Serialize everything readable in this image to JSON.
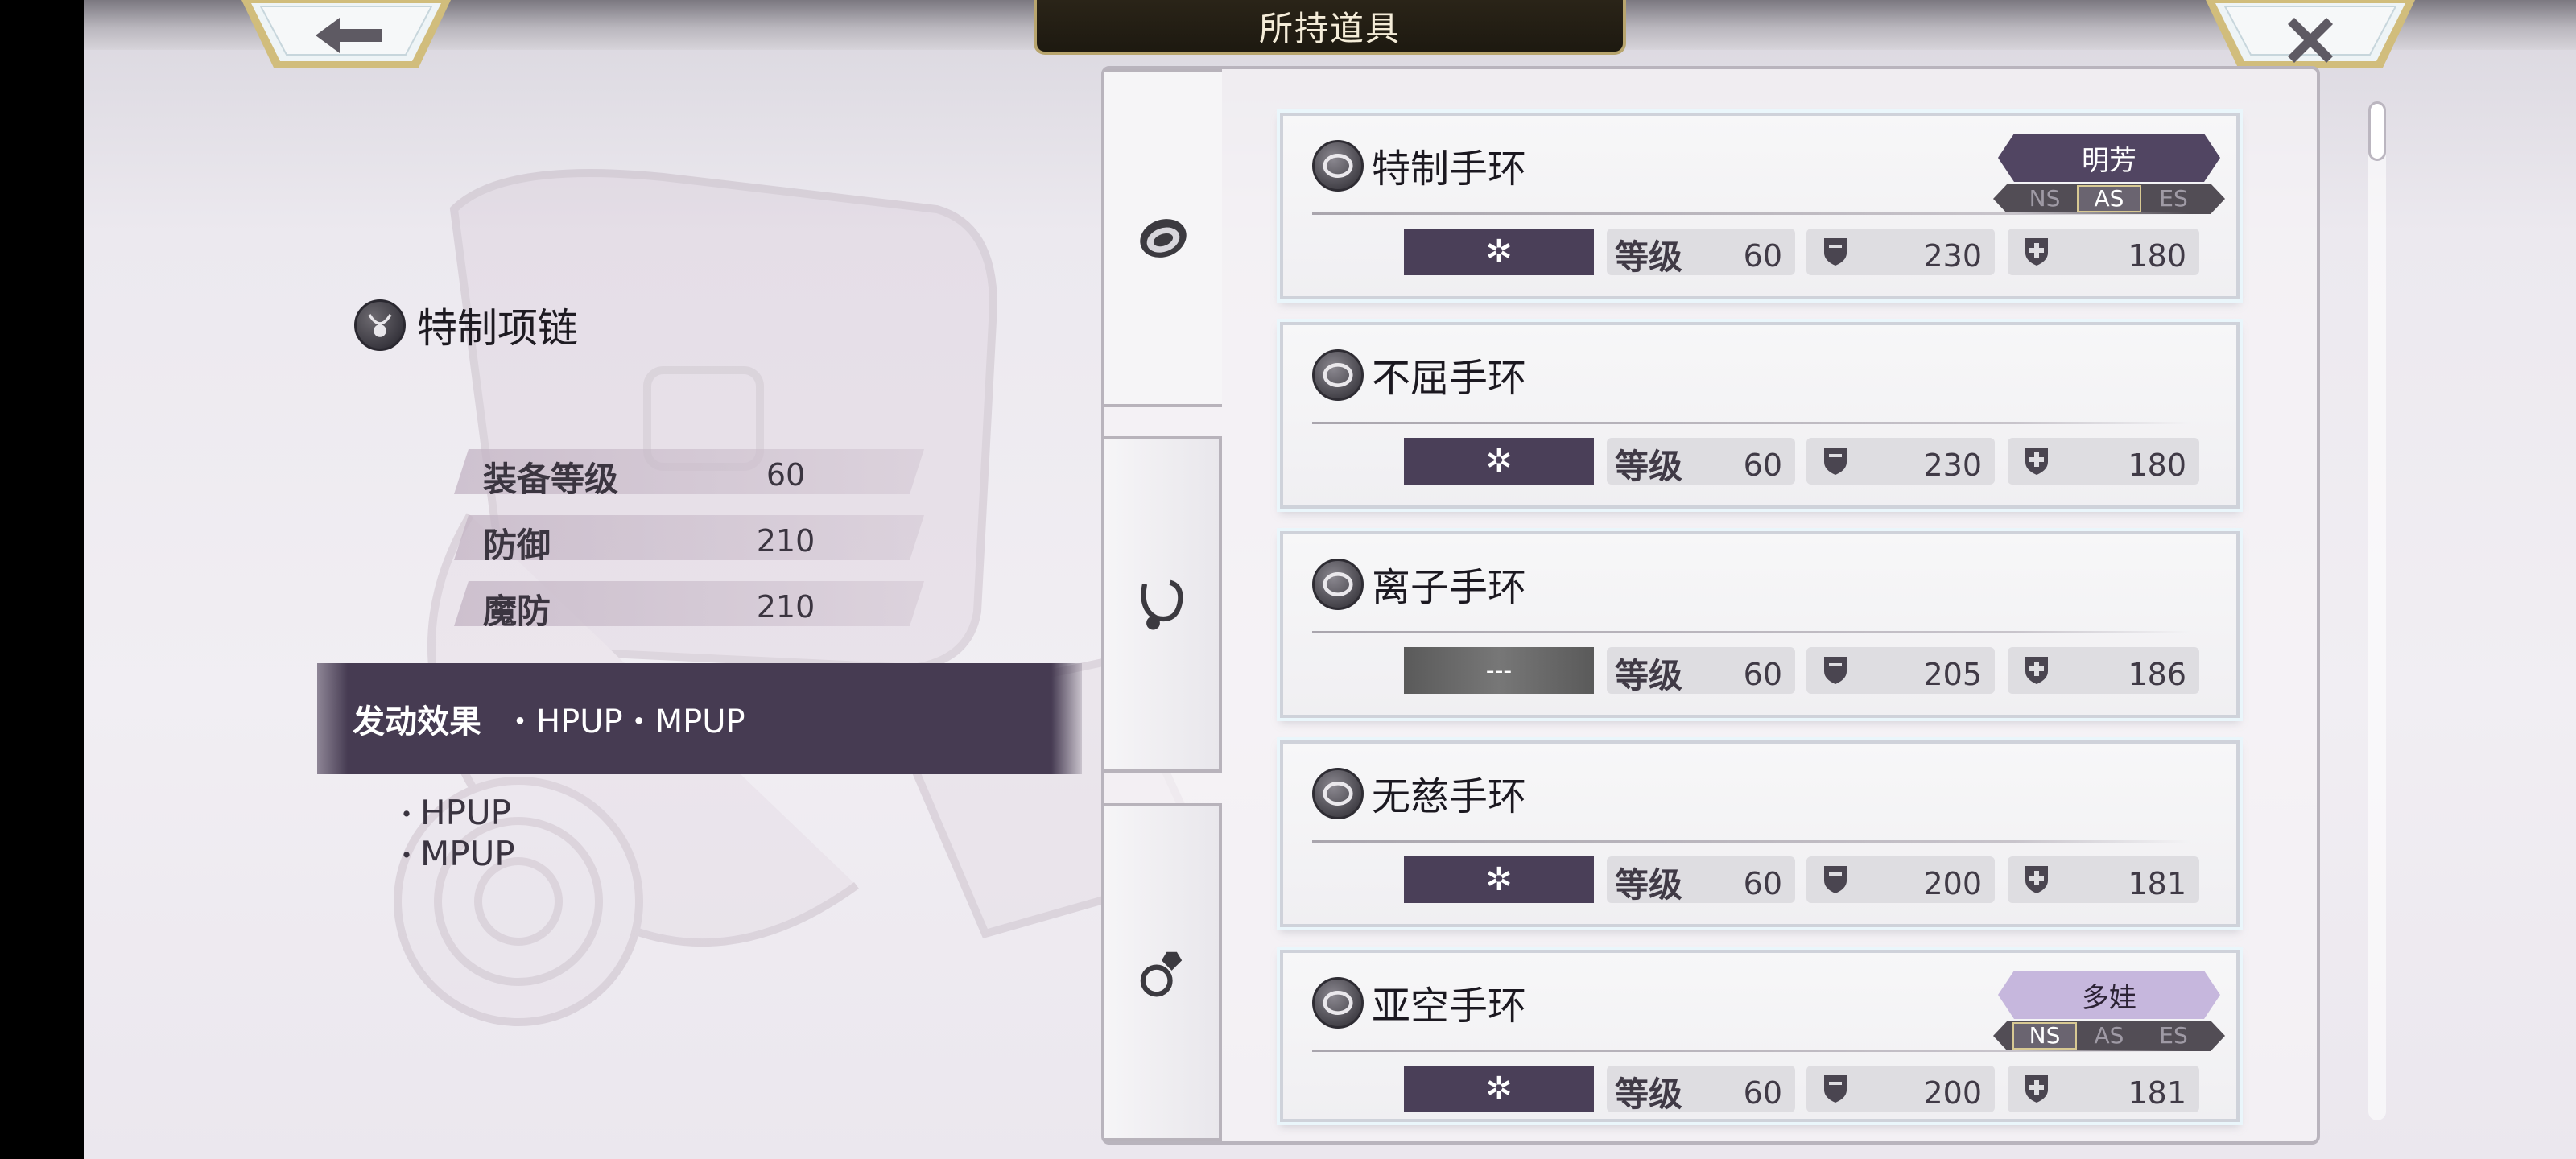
{
  "header": {
    "title": "所持道具",
    "back_icon": "arrow-left-icon",
    "close_icon": "close-icon"
  },
  "detail": {
    "item_name": "特制项链",
    "stats": [
      {
        "label": "装备等级",
        "value": "60"
      },
      {
        "label": "防御",
        "value": "210"
      },
      {
        "label": "魔防",
        "value": "210"
      }
    ],
    "effect_label": "发动效果",
    "effect_value": "・HPUP・MPUP",
    "effects": [
      "HPUP",
      "MPUP"
    ]
  },
  "tabs": [
    {
      "icon": "bracelet-icon"
    },
    {
      "icon": "necklace-icon"
    },
    {
      "icon": "ring-icon"
    }
  ],
  "list": {
    "level_label": "等级",
    "items": [
      {
        "name": "特制手环",
        "slot": "✲",
        "level": "60",
        "def": "230",
        "mdef": "180",
        "owner": "明芳",
        "owner_style": "dark",
        "styles": [
          "NS",
          "AS",
          "ES"
        ],
        "active_style": "AS"
      },
      {
        "name": "不屈手环",
        "slot": "✲",
        "level": "60",
        "def": "230",
        "mdef": "180"
      },
      {
        "name": "离子手环",
        "slot": "---",
        "level": "60",
        "def": "205",
        "mdef": "186"
      },
      {
        "name": "无慈手环",
        "slot": "✲",
        "level": "60",
        "def": "200",
        "mdef": "181"
      },
      {
        "name": "亚空手环",
        "slot": "✲",
        "level": "60",
        "def": "200",
        "mdef": "181",
        "owner": "多娃",
        "owner_style": "light",
        "styles": [
          "NS",
          "AS",
          "ES"
        ],
        "active_style": "NS"
      }
    ]
  },
  "colors": {
    "accent_dark": "#463b52",
    "gold": "#b8a56e",
    "owner_light": "#c6b7dd"
  }
}
